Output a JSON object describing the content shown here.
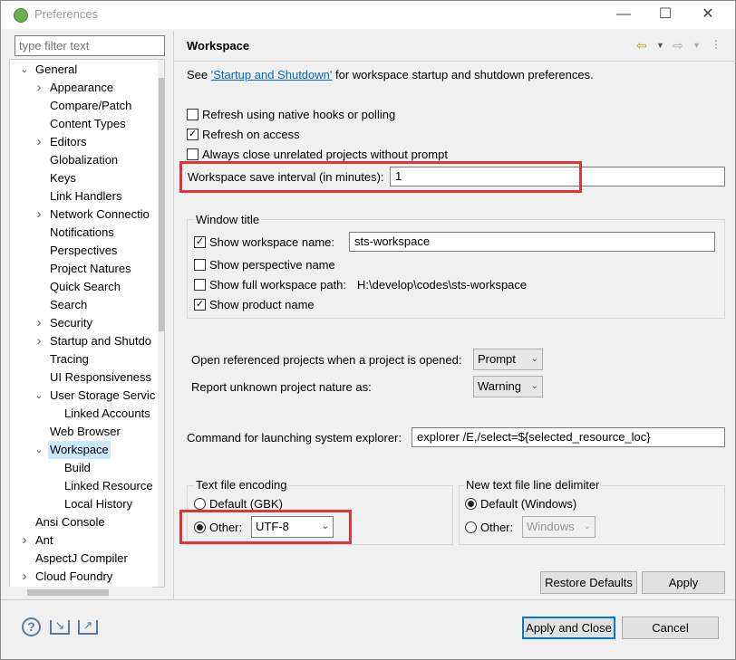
{
  "window": {
    "title": "Preferences"
  },
  "filter": {
    "placeholder": "type filter text"
  },
  "tree": {
    "items": [
      {
        "label": "General",
        "level": 0,
        "arrow": "v"
      },
      {
        "label": "Appearance",
        "level": 1,
        "arrow": ">"
      },
      {
        "label": "Compare/Patch",
        "level": 1,
        "arrow": ""
      },
      {
        "label": "Content Types",
        "level": 1,
        "arrow": ""
      },
      {
        "label": "Editors",
        "level": 1,
        "arrow": ">"
      },
      {
        "label": "Globalization",
        "level": 1,
        "arrow": ""
      },
      {
        "label": "Keys",
        "level": 1,
        "arrow": ""
      },
      {
        "label": "Link Handlers",
        "level": 1,
        "arrow": ""
      },
      {
        "label": "Network Connectio",
        "level": 1,
        "arrow": ">"
      },
      {
        "label": "Notifications",
        "level": 1,
        "arrow": ""
      },
      {
        "label": "Perspectives",
        "level": 1,
        "arrow": ""
      },
      {
        "label": "Project Natures",
        "level": 1,
        "arrow": ""
      },
      {
        "label": "Quick Search",
        "level": 1,
        "arrow": ""
      },
      {
        "label": "Search",
        "level": 1,
        "arrow": ""
      },
      {
        "label": "Security",
        "level": 1,
        "arrow": ">"
      },
      {
        "label": "Startup and Shutdo",
        "level": 1,
        "arrow": ">"
      },
      {
        "label": "Tracing",
        "level": 1,
        "arrow": ""
      },
      {
        "label": "UI Responsiveness",
        "level": 1,
        "arrow": ""
      },
      {
        "label": "User Storage Servic",
        "level": 1,
        "arrow": "v"
      },
      {
        "label": "Linked Accounts",
        "level": 2,
        "arrow": ""
      },
      {
        "label": "Web Browser",
        "level": 1,
        "arrow": ""
      },
      {
        "label": "Workspace",
        "level": 1,
        "arrow": "v",
        "selected": true
      },
      {
        "label": "Build",
        "level": 2,
        "arrow": ""
      },
      {
        "label": "Linked Resource",
        "level": 2,
        "arrow": ""
      },
      {
        "label": "Local History",
        "level": 2,
        "arrow": ""
      },
      {
        "label": "Ansi Console",
        "level": 0,
        "arrow": ""
      },
      {
        "label": "Ant",
        "level": 0,
        "arrow": ">"
      },
      {
        "label": "AspectJ Compiler",
        "level": 0,
        "arrow": ""
      },
      {
        "label": "Cloud Foundry",
        "level": 0,
        "arrow": ">"
      }
    ]
  },
  "page": {
    "title": "Workspace",
    "see_prefix": "See ",
    "see_link": "'Startup and Shutdown'",
    "see_suffix": " for workspace startup and shutdown preferences.",
    "refresh_native": {
      "label": "Refresh using native hooks or polling",
      "checked": false
    },
    "refresh_access": {
      "label": "Refresh on access",
      "checked": true
    },
    "always_close": {
      "label": "Always close unrelated projects without prompt",
      "checked": false
    },
    "save_interval_label": "Workspace save interval (in minutes):",
    "save_interval_value": "1",
    "window_title_group": "Window title",
    "show_ws_name": {
      "label": "Show workspace name:",
      "checked": true
    },
    "ws_name_value": "sts-workspace",
    "show_perspective": {
      "label": "Show perspective name",
      "checked": false
    },
    "show_full_path": {
      "label": "Show full workspace path:",
      "checked": false
    },
    "full_path_value": "H:\\develop\\codes\\sts-workspace",
    "show_product": {
      "label": "Show product name",
      "checked": true
    },
    "open_ref_label": "Open referenced projects when a project is opened:",
    "open_ref_value": "Prompt",
    "report_nature_label": "Report unknown project nature as:",
    "report_nature_value": "Warning",
    "cmd_label": "Command for launching system explorer:",
    "cmd_value": "explorer /E,/select=${selected_resource_loc}",
    "encoding_group": "Text file encoding",
    "enc_default": "Default (GBK)",
    "enc_other": "Other:",
    "enc_other_value": "UTF-8",
    "delim_group": "New text file line delimiter",
    "delim_default": "Default (Windows)",
    "delim_other": "Other:",
    "delim_other_value": "Windows",
    "restore_defaults": "Restore Defaults",
    "apply": "Apply"
  },
  "footer": {
    "apply_close": "Apply and Close",
    "cancel": "Cancel"
  },
  "colors": {
    "highlight": "#d9383a",
    "selection": "#cce8ff",
    "link": "#0066cc"
  }
}
